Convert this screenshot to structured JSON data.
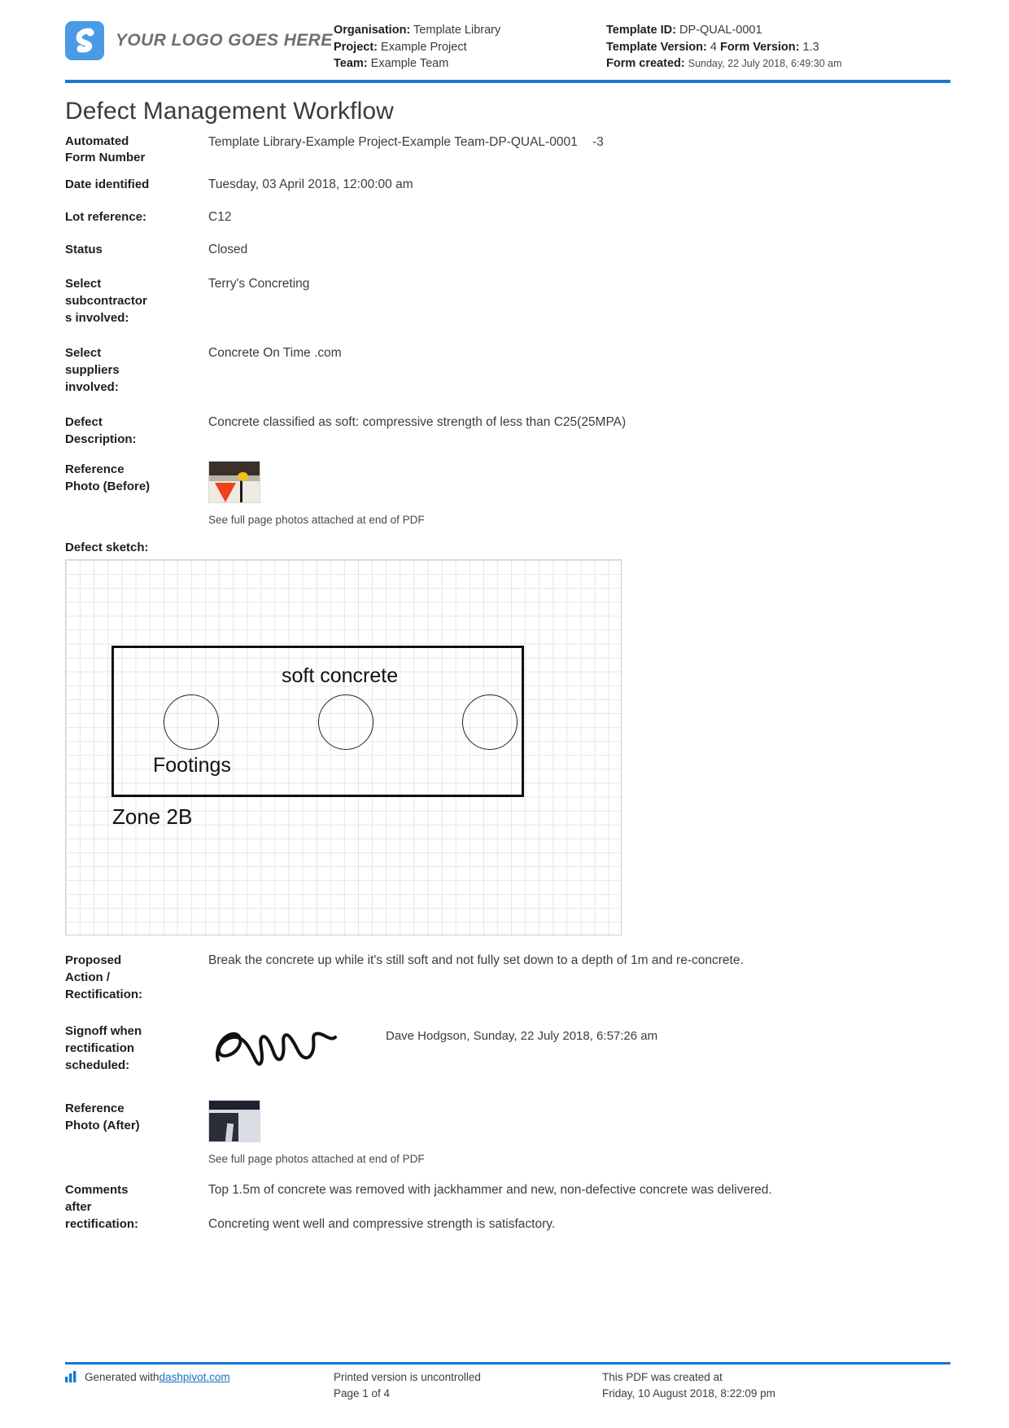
{
  "header": {
    "logo_text": "YOUR LOGO GOES HERE",
    "logo_icon": "dashpivot-logo-icon",
    "left_meta": [
      {
        "label": "Organisation:",
        "value": "Template Library"
      },
      {
        "label": "Project:",
        "value": "Example Project"
      },
      {
        "label": "Team:",
        "value": "Example Team"
      }
    ],
    "right_meta": {
      "template_id_label": "Template ID:",
      "template_id_value": "DP-QUAL-0001",
      "template_version_label": "Template Version:",
      "template_version_value": "4",
      "form_version_label": "Form Version:",
      "form_version_value": "1.3",
      "form_created_label": "Form created:",
      "form_created_value": "Sunday, 22 July 2018, 6:49:30 am"
    }
  },
  "title": "Defect Management Workflow",
  "fields": {
    "automated_form_number": {
      "label": "Automated Form Number",
      "value": "Template Library-Example Project-Example Team-DP-QUAL-0001",
      "suffix": "-3"
    },
    "date_identified": {
      "label": "Date identified",
      "value": "Tuesday, 03 April 2018, 12:00:00 am"
    },
    "lot_reference": {
      "label": "Lot reference:",
      "value": "C12"
    },
    "status": {
      "label": "Status",
      "value": "Closed"
    },
    "subcontractors": {
      "label": "Select subcontractor s involved:",
      "value": "Terry's Concreting"
    },
    "suppliers": {
      "label": "Select suppliers involved:",
      "value": "Concrete On Time .com"
    },
    "defect_description": {
      "label": "Defect Description:",
      "value": "Concrete classified as soft: compressive strength of less than C25(25MPA)"
    },
    "reference_photo_before": {
      "label": "Reference Photo (Before)",
      "caption": "See full page photos attached at end of PDF",
      "thumbnail_icon": "photo-thumbnail-traffic-cone"
    },
    "defect_sketch": {
      "label": "Defect sketch:"
    },
    "proposed_action": {
      "label": "Proposed Action / Rectification:",
      "value": "Break the concrete up while it's still soft and not fully set down to a depth of 1m and re-concrete."
    },
    "signoff": {
      "label": "Signoff when rectification scheduled:",
      "signature_icon": "handwritten-signature",
      "value": "Dave Hodgson, Sunday, 22 July 2018, 6:57:26 am"
    },
    "reference_photo_after": {
      "label": "Reference Photo (After)",
      "caption": "See full page photos attached at end of PDF",
      "thumbnail_icon": "photo-thumbnail-night-site"
    },
    "comments_after_rectification": {
      "label": "Comments after rectification:",
      "value_line1": "Top 1.5m of concrete was removed with jackhammer and new, non-defective concrete was delivered.",
      "value_line2": "Concreting went well and compressive strength is satisfactory."
    }
  },
  "sketch": {
    "label_soft": "soft concrete",
    "label_footings": "Footings",
    "label_zone": "Zone 2B"
  },
  "footer": {
    "generated_prefix": "Generated with ",
    "generated_link": "dashpivot.com",
    "printed_line1": "Printed version is uncontrolled",
    "printed_line2": "Page 1 of 4",
    "created_line1": "This PDF was created at",
    "created_line2": "Friday, 10 August 2018, 8:22:09 pm",
    "bars_icon": "bar-chart-icon"
  },
  "colors": {
    "accent_blue": "#1679d4",
    "logo_blue": "#4a9ae6",
    "link_blue": "#1a6fc4"
  }
}
